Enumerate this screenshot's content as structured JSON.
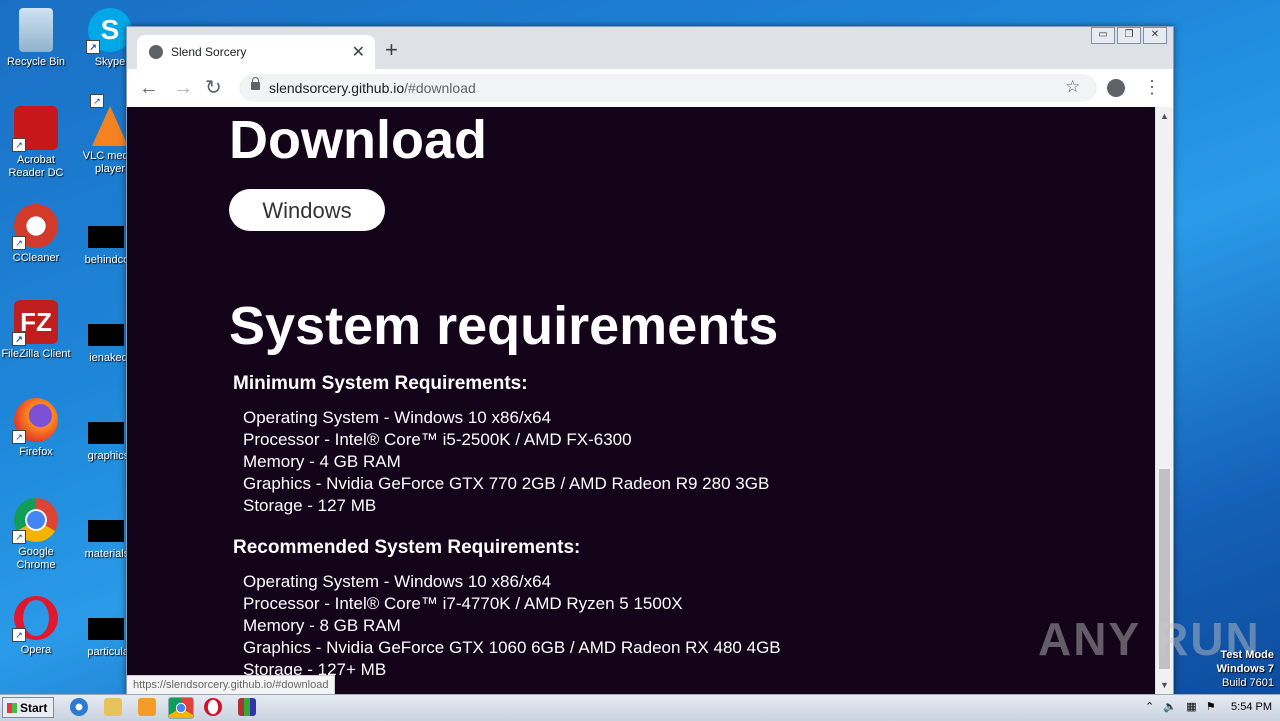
{
  "desktop": {
    "icons_left": [
      {
        "label": "Recycle Bin",
        "icon": "recycle-bin-icon"
      },
      {
        "label": "Acrobat Reader DC",
        "icon": "acrobat-icon"
      },
      {
        "label": "CCleaner",
        "icon": "ccleaner-icon"
      },
      {
        "label": "FileZilla Client",
        "icon": "filezilla-icon"
      },
      {
        "label": "Firefox",
        "icon": "firefox-icon"
      },
      {
        "label": "Google Chrome",
        "icon": "chrome-icon"
      },
      {
        "label": "Opera",
        "icon": "opera-icon"
      }
    ],
    "icons_right": [
      {
        "label": "Skype",
        "icon": "skype-icon"
      },
      {
        "label": "VLC media player",
        "icon": "vlc-icon"
      },
      {
        "label": "behindcon",
        "icon": "file-icon"
      },
      {
        "label": "ienaked.",
        "icon": "file-icon"
      },
      {
        "label": "graphicsf",
        "icon": "file-icon"
      },
      {
        "label": "materialsa",
        "icon": "file-icon"
      },
      {
        "label": "particular",
        "icon": "file-icon"
      }
    ]
  },
  "browser": {
    "tab_title": "Slend Sorcery",
    "url_host": "slendsorcery.github.io",
    "url_path": "/#download",
    "status_url": "https://slendsorcery.github.io/#download"
  },
  "page": {
    "download_heading": "Download",
    "windows_button": "Windows",
    "sysreq_heading": "System requirements",
    "minimum": {
      "title": "Minimum System Requirements:",
      "items": [
        "Operating System - Windows 10 x86/x64",
        "Processor - Intel® Core™ i5-2500K / AMD FX-6300",
        "Memory - 4 GB RAM",
        "Graphics - Nvidia GeForce GTX 770 2GB / AMD Radeon R9 280 3GB",
        "Storage - 127 MB"
      ]
    },
    "recommended": {
      "title": "Recommended System Requirements:",
      "items": [
        "Operating System - Windows 10 x86/x64",
        "Processor - Intel® Core™ i7-4770K / AMD Ryzen 5 1500X",
        "Memory - 8 GB RAM",
        "Graphics - Nvidia GeForce GTX 1060 6GB / AMD Radeon RX 480 4GB",
        "Storage - 127+ MB"
      ]
    }
  },
  "watermark": "ANY RUN",
  "system": {
    "test_mode": "Test Mode",
    "os": "Windows 7",
    "build": "Build 7601",
    "clock": "5:54 PM",
    "start_label": "Start"
  }
}
